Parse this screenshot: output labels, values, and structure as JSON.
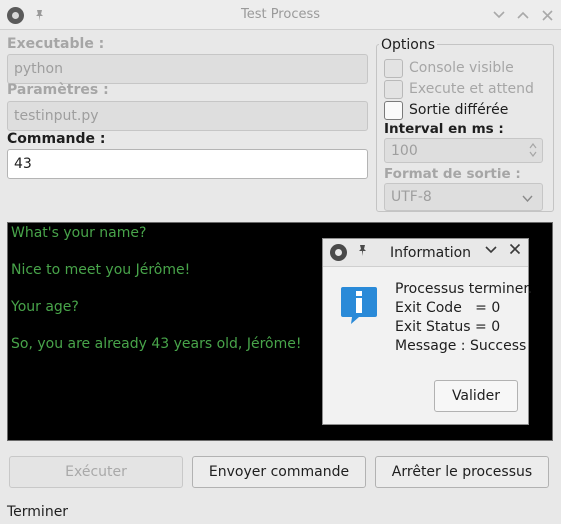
{
  "window": {
    "title": "Test Process"
  },
  "form": {
    "executable_label": "Executable :",
    "executable_value": "python",
    "params_label": "Paramètres :",
    "params_value": "testinput.py",
    "command_label": "Commande :",
    "command_value": "43"
  },
  "options": {
    "title": "Options",
    "console_visible": {
      "label": "Console visible",
      "checked": false,
      "enabled": false
    },
    "execute_wait": {
      "label": "Execute et attend",
      "checked": false,
      "enabled": false
    },
    "deferred_output": {
      "label": "Sortie différée",
      "checked": false,
      "enabled": true
    },
    "interval_label": "Interval  en ms :",
    "interval_value": "100",
    "format_label": "Format de sortie :",
    "format_value": "UTF-8"
  },
  "console": {
    "lines": [
      "What's your name?",
      "Nice to meet you Jérôme!",
      "Your age?",
      "So, you are already 43 years old, Jérôme!"
    ],
    "text_color": "#48a44a"
  },
  "buttons": {
    "execute": "Exécuter",
    "send_command": "Envoyer commande",
    "stop_process": "Arrêter le processus"
  },
  "status": "Terminer",
  "dialog": {
    "title": "Information",
    "lines": [
      "Processus terminer.",
      "Exit Code   = 0",
      "Exit Status = 0",
      "Message : Success"
    ],
    "ok_button": "Valider",
    "icon": "info-icon"
  },
  "colors": {
    "info_blue": "#2a8ad8"
  }
}
